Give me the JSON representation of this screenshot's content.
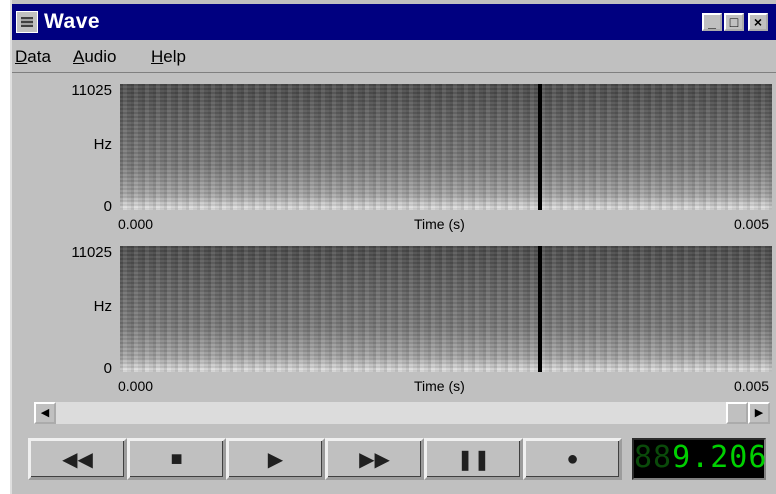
{
  "window": {
    "title": "Wave"
  },
  "titlebar_buttons": {
    "minimize": "_",
    "maximize": "□",
    "close": "×"
  },
  "menu": [
    {
      "underline": "D",
      "rest": "ata"
    },
    {
      "underline": "A",
      "rest": "udio"
    },
    {
      "underline": "H",
      "rest": "elp"
    }
  ],
  "spectrograms": [
    {
      "y_max": "11025",
      "y_unit": "Hz",
      "y_min": "0",
      "x_start": "0.000",
      "x_label": "Time (s)",
      "x_end": "0.005",
      "cursor_position": 0.64
    },
    {
      "y_max": "11025",
      "y_unit": "Hz",
      "y_min": "0",
      "x_start": "0.000",
      "x_label": "Time (s)",
      "x_end": "0.005",
      "cursor_position": 0.64
    }
  ],
  "scrollbar": {
    "left_arrow": "◀",
    "right_arrow": "▶",
    "position": 1.0
  },
  "transport": {
    "rewind": "◀◀",
    "stop": "■",
    "play": "▶",
    "fast_forward": "▶▶",
    "pause": "❚❚",
    "record": "●"
  },
  "counter": {
    "ghost_digits": "88",
    "value": "9.206"
  },
  "colors": {
    "titlebar": "#000080",
    "face": "#c0c0c0",
    "lcd_text": "#00d000"
  }
}
